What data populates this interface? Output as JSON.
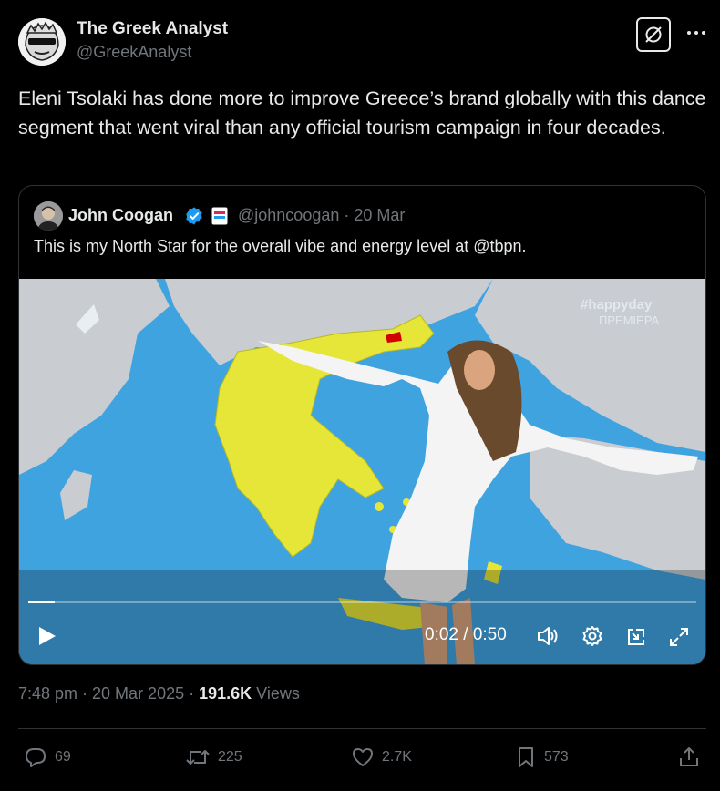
{
  "author": {
    "display_name": "The Greek Analyst",
    "handle": "@GreekAnalyst"
  },
  "header_icons": [
    "grok-icon",
    "more-icon"
  ],
  "tweet": {
    "text": "Eleni Tsolaki has done more to improve Greece’s brand globally with this dance segment that went viral than any official tourism campaign in four decades."
  },
  "quote": {
    "display_name": "John Coogan",
    "handle_and_date": "@johncoogan · 20 Mar",
    "text": "This is my North Star for the overall vibe and energy level at @tbpn.",
    "video": {
      "watermark_line1": "#happyday",
      "watermark_line2": "ΠΡΕΜΙΕΡΑ",
      "timecode": "0:02 / 0:50",
      "progress": 0.04
    }
  },
  "meta": {
    "time_date": "7:48 pm · 20 Mar 2025 · ",
    "views_count": "191.6K",
    "views_label": " Views"
  },
  "actions": {
    "replies": "69",
    "reposts": "225",
    "likes": "2.7K",
    "bookmarks": "573"
  },
  "colors": {
    "background": "#000000",
    "text": "#e7e9ea",
    "secondary": "#71767b",
    "border": "#2f3336",
    "verified": "#1d9bf0",
    "sea": "#3fa3e0",
    "greece": "#e6e639"
  }
}
